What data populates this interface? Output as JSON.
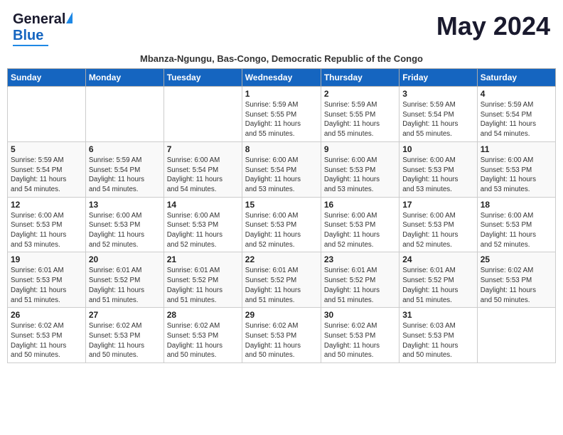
{
  "header": {
    "logo_general": "General",
    "logo_blue": "Blue",
    "month_title": "May 2024",
    "subtitle": "Mbanza-Ngungu, Bas-Congo, Democratic Republic of the Congo"
  },
  "calendar": {
    "days_of_week": [
      "Sunday",
      "Monday",
      "Tuesday",
      "Wednesday",
      "Thursday",
      "Friday",
      "Saturday"
    ],
    "weeks": [
      {
        "days": [
          {
            "num": "",
            "info": ""
          },
          {
            "num": "",
            "info": ""
          },
          {
            "num": "",
            "info": ""
          },
          {
            "num": "1",
            "info": "Sunrise: 5:59 AM\nSunset: 5:55 PM\nDaylight: 11 hours\nand 55 minutes."
          },
          {
            "num": "2",
            "info": "Sunrise: 5:59 AM\nSunset: 5:55 PM\nDaylight: 11 hours\nand 55 minutes."
          },
          {
            "num": "3",
            "info": "Sunrise: 5:59 AM\nSunset: 5:54 PM\nDaylight: 11 hours\nand 55 minutes."
          },
          {
            "num": "4",
            "info": "Sunrise: 5:59 AM\nSunset: 5:54 PM\nDaylight: 11 hours\nand 54 minutes."
          }
        ]
      },
      {
        "days": [
          {
            "num": "5",
            "info": "Sunrise: 5:59 AM\nSunset: 5:54 PM\nDaylight: 11 hours\nand 54 minutes."
          },
          {
            "num": "6",
            "info": "Sunrise: 5:59 AM\nSunset: 5:54 PM\nDaylight: 11 hours\nand 54 minutes."
          },
          {
            "num": "7",
            "info": "Sunrise: 6:00 AM\nSunset: 5:54 PM\nDaylight: 11 hours\nand 54 minutes."
          },
          {
            "num": "8",
            "info": "Sunrise: 6:00 AM\nSunset: 5:54 PM\nDaylight: 11 hours\nand 53 minutes."
          },
          {
            "num": "9",
            "info": "Sunrise: 6:00 AM\nSunset: 5:53 PM\nDaylight: 11 hours\nand 53 minutes."
          },
          {
            "num": "10",
            "info": "Sunrise: 6:00 AM\nSunset: 5:53 PM\nDaylight: 11 hours\nand 53 minutes."
          },
          {
            "num": "11",
            "info": "Sunrise: 6:00 AM\nSunset: 5:53 PM\nDaylight: 11 hours\nand 53 minutes."
          }
        ]
      },
      {
        "days": [
          {
            "num": "12",
            "info": "Sunrise: 6:00 AM\nSunset: 5:53 PM\nDaylight: 11 hours\nand 53 minutes."
          },
          {
            "num": "13",
            "info": "Sunrise: 6:00 AM\nSunset: 5:53 PM\nDaylight: 11 hours\nand 52 minutes."
          },
          {
            "num": "14",
            "info": "Sunrise: 6:00 AM\nSunset: 5:53 PM\nDaylight: 11 hours\nand 52 minutes."
          },
          {
            "num": "15",
            "info": "Sunrise: 6:00 AM\nSunset: 5:53 PM\nDaylight: 11 hours\nand 52 minutes."
          },
          {
            "num": "16",
            "info": "Sunrise: 6:00 AM\nSunset: 5:53 PM\nDaylight: 11 hours\nand 52 minutes."
          },
          {
            "num": "17",
            "info": "Sunrise: 6:00 AM\nSunset: 5:53 PM\nDaylight: 11 hours\nand 52 minutes."
          },
          {
            "num": "18",
            "info": "Sunrise: 6:00 AM\nSunset: 5:53 PM\nDaylight: 11 hours\nand 52 minutes."
          }
        ]
      },
      {
        "days": [
          {
            "num": "19",
            "info": "Sunrise: 6:01 AM\nSunset: 5:53 PM\nDaylight: 11 hours\nand 51 minutes."
          },
          {
            "num": "20",
            "info": "Sunrise: 6:01 AM\nSunset: 5:52 PM\nDaylight: 11 hours\nand 51 minutes."
          },
          {
            "num": "21",
            "info": "Sunrise: 6:01 AM\nSunset: 5:52 PM\nDaylight: 11 hours\nand 51 minutes."
          },
          {
            "num": "22",
            "info": "Sunrise: 6:01 AM\nSunset: 5:52 PM\nDaylight: 11 hours\nand 51 minutes."
          },
          {
            "num": "23",
            "info": "Sunrise: 6:01 AM\nSunset: 5:52 PM\nDaylight: 11 hours\nand 51 minutes."
          },
          {
            "num": "24",
            "info": "Sunrise: 6:01 AM\nSunset: 5:52 PM\nDaylight: 11 hours\nand 51 minutes."
          },
          {
            "num": "25",
            "info": "Sunrise: 6:02 AM\nSunset: 5:53 PM\nDaylight: 11 hours\nand 50 minutes."
          }
        ]
      },
      {
        "days": [
          {
            "num": "26",
            "info": "Sunrise: 6:02 AM\nSunset: 5:53 PM\nDaylight: 11 hours\nand 50 minutes."
          },
          {
            "num": "27",
            "info": "Sunrise: 6:02 AM\nSunset: 5:53 PM\nDaylight: 11 hours\nand 50 minutes."
          },
          {
            "num": "28",
            "info": "Sunrise: 6:02 AM\nSunset: 5:53 PM\nDaylight: 11 hours\nand 50 minutes."
          },
          {
            "num": "29",
            "info": "Sunrise: 6:02 AM\nSunset: 5:53 PM\nDaylight: 11 hours\nand 50 minutes."
          },
          {
            "num": "30",
            "info": "Sunrise: 6:02 AM\nSunset: 5:53 PM\nDaylight: 11 hours\nand 50 minutes."
          },
          {
            "num": "31",
            "info": "Sunrise: 6:03 AM\nSunset: 5:53 PM\nDaylight: 11 hours\nand 50 minutes."
          },
          {
            "num": "",
            "info": ""
          }
        ]
      }
    ]
  }
}
